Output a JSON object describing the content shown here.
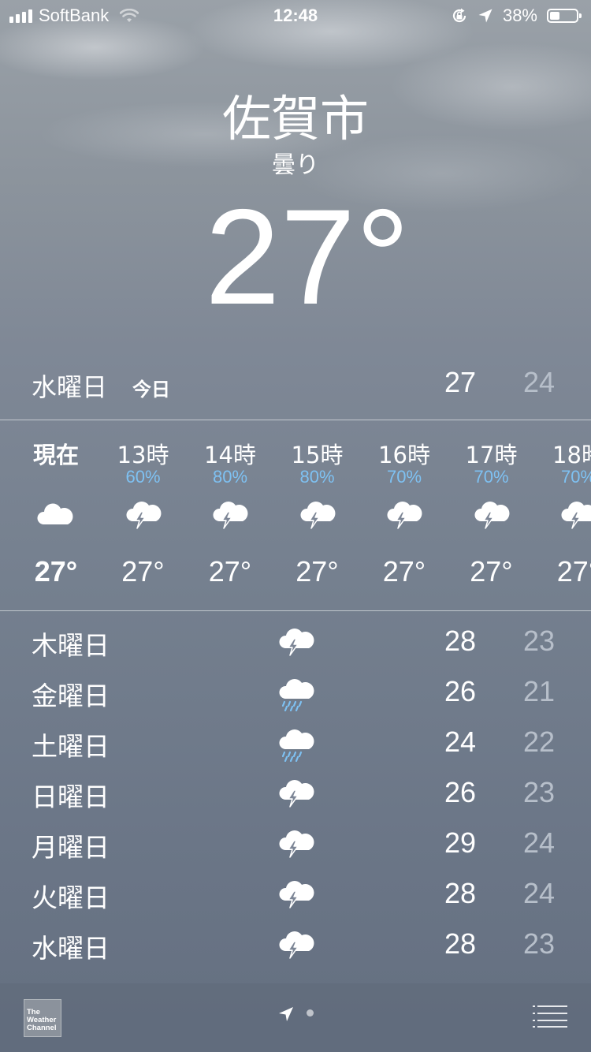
{
  "status_bar": {
    "carrier": "SoftBank",
    "time": "12:48",
    "battery": "38%",
    "battery_level": 0.38,
    "icons": [
      "signal-icon",
      "wifi-icon",
      "orientation-lock-icon",
      "location-arrow-icon",
      "battery-icon"
    ]
  },
  "location": {
    "city": "佐賀市",
    "condition": "曇り",
    "temperature": "27°"
  },
  "today": {
    "day": "水曜日",
    "label": "今日",
    "high": "27",
    "low": "24"
  },
  "hourly": [
    {
      "time": "現在",
      "pop": "",
      "icon": "cloud-icon",
      "temp": "27°"
    },
    {
      "time": "13時",
      "pop": "60%",
      "icon": "thunderstorm-icon",
      "temp": "27°"
    },
    {
      "time": "14時",
      "pop": "80%",
      "icon": "thunderstorm-icon",
      "temp": "27°"
    },
    {
      "time": "15時",
      "pop": "80%",
      "icon": "thunderstorm-icon",
      "temp": "27°"
    },
    {
      "time": "16時",
      "pop": "70%",
      "icon": "thunderstorm-icon",
      "temp": "27°"
    },
    {
      "time": "17時",
      "pop": "70%",
      "icon": "thunderstorm-icon",
      "temp": "27°"
    },
    {
      "time": "18時",
      "pop": "70%",
      "icon": "thunderstorm-icon",
      "temp": "27°"
    }
  ],
  "daily": [
    {
      "day": "木曜日",
      "icon": "thunderstorm-icon",
      "high": "28",
      "low": "23"
    },
    {
      "day": "金曜日",
      "icon": "rain-icon",
      "high": "26",
      "low": "21"
    },
    {
      "day": "土曜日",
      "icon": "rain-icon",
      "high": "24",
      "low": "22"
    },
    {
      "day": "日曜日",
      "icon": "thunderstorm-icon",
      "high": "26",
      "low": "23"
    },
    {
      "day": "月曜日",
      "icon": "thunderstorm-icon",
      "high": "29",
      "low": "24"
    },
    {
      "day": "火曜日",
      "icon": "thunderstorm-icon",
      "high": "28",
      "low": "24"
    },
    {
      "day": "水曜日",
      "icon": "thunderstorm-icon",
      "high": "28",
      "low": "23"
    }
  ],
  "bottom_bar": {
    "logo_lines": [
      "The",
      "Weather",
      "Channel"
    ],
    "icons": [
      "weather-channel-logo",
      "location-arrow-icon",
      "page-dot",
      "list-icon"
    ]
  },
  "colors": {
    "precip_blue": "#7ec1f2",
    "low_temp_gray": "#b7bfca"
  }
}
